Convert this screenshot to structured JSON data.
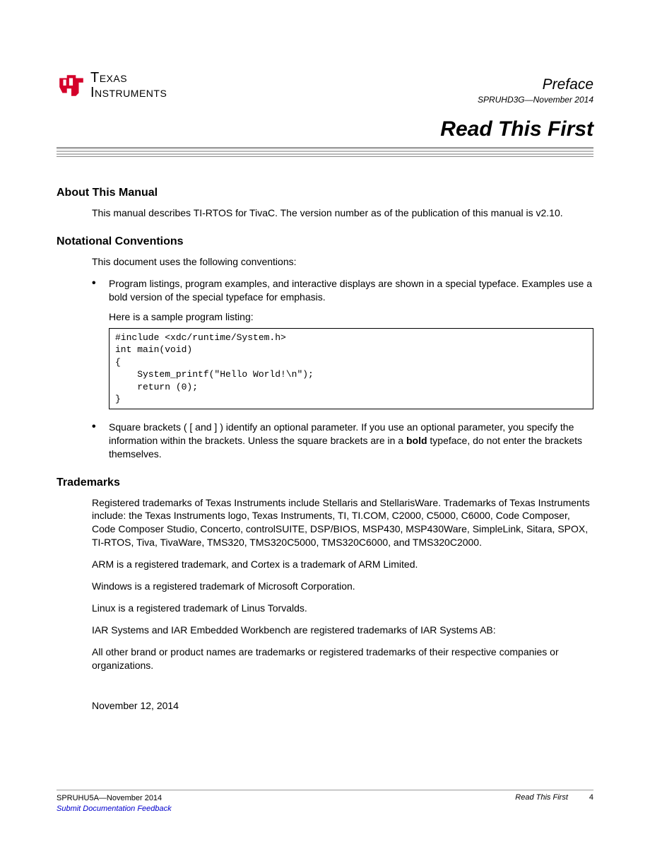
{
  "logo": {
    "line1": "Texas",
    "line2": "Instruments"
  },
  "header": {
    "preface": "Preface",
    "doc_id": "SPRUHD3G—November 2014",
    "title": "Read This First"
  },
  "sections": {
    "about": {
      "heading": "About This Manual",
      "p1": "This manual describes TI-RTOS for TivaC. The version number as of the publication of this manual is v2.10."
    },
    "conventions": {
      "heading": "Notational Conventions",
      "intro": "This document uses the following conventions:",
      "bullet1": "Program listings, program examples, and interactive displays are shown in a special typeface. Examples use a bold version of the special typeface for emphasis.",
      "sample_label": "Here is a sample program listing:",
      "code": "#include <xdc/runtime/System.h>\nint main(void)\n{\n    System_printf(\"Hello World!\\n\");\n    return (0);\n}",
      "bullet2_a": "Square brackets ( [ and ] ) identify an optional parameter. If you use an optional parameter, you specify the information within the brackets. Unless the square brackets are in a ",
      "bullet2_bold": "bold",
      "bullet2_b": " typeface, do not enter the brackets themselves."
    },
    "trademarks": {
      "heading": "Trademarks",
      "p1": "Registered trademarks of Texas Instruments include Stellaris and StellarisWare. Trademarks of Texas Instruments include: the Texas Instruments logo, Texas Instruments, TI, TI.COM, C2000, C5000, C6000, Code Composer, Code Composer Studio, Concerto, controlSUITE, DSP/BIOS, MSP430, MSP430Ware, SimpleLink, Sitara, SPOX, TI-RTOS, Tiva, TivaWare, TMS320, TMS320C5000, TMS320C6000, and TMS320C2000.",
      "p2": "ARM is a registered trademark, and Cortex is a trademark of ARM Limited.",
      "p3": "Windows is a registered trademark of Microsoft Corporation.",
      "p4": "Linux is a registered trademark of Linus Torvalds.",
      "p5": "IAR Systems and IAR Embedded Workbench are registered trademarks of IAR Systems AB:",
      "p6": "All other brand or product names are trademarks or registered trademarks of their respective companies or organizations."
    },
    "date": "November 12, 2014"
  },
  "footer": {
    "left_id": "SPRUHU5A—November 2014",
    "feedback": "Submit Documentation Feedback",
    "right_title": "Read This First",
    "page": "4"
  }
}
